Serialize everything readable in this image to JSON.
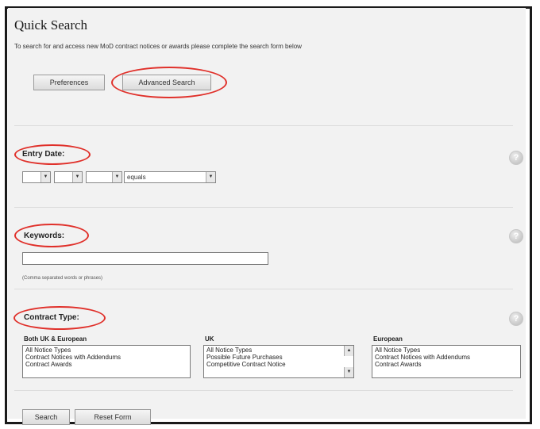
{
  "header": {
    "title": "Quick Search",
    "intro": "To search for and access new MoD contract notices or awards please complete the search form below"
  },
  "toolbar": {
    "preferences_label": "Preferences",
    "advanced_search_label": "Advanced Search"
  },
  "entry_date": {
    "label": "Entry Date:",
    "day_value": "",
    "month_value": "",
    "year_value": "",
    "operator_value": "equals"
  },
  "keywords": {
    "label": "Keywords:",
    "value": "",
    "hint": "(Comma separated words or phrases)"
  },
  "contract_type": {
    "label": "Contract Type:",
    "columns": [
      {
        "heading": "Both UK & European",
        "options": [
          "All Notice Types",
          "Contract Notices with Addendums",
          "Contract Awards"
        ]
      },
      {
        "heading": "UK",
        "options": [
          "All Notice Types",
          "Possible Future Purchases",
          "Competitive Contract Notice"
        ]
      },
      {
        "heading": "European",
        "options": [
          "All Notice Types",
          "Contract Notices with Addendums",
          "Contract Awards"
        ]
      }
    ]
  },
  "footer": {
    "search_label": "Search",
    "reset_label": "Reset Form"
  },
  "icons": {
    "help": "help-icon",
    "dropdown": "chevron-down-icon"
  },
  "colors": {
    "highlight_oval": "#e0302a",
    "panel_bg": "#f2f2f2"
  }
}
